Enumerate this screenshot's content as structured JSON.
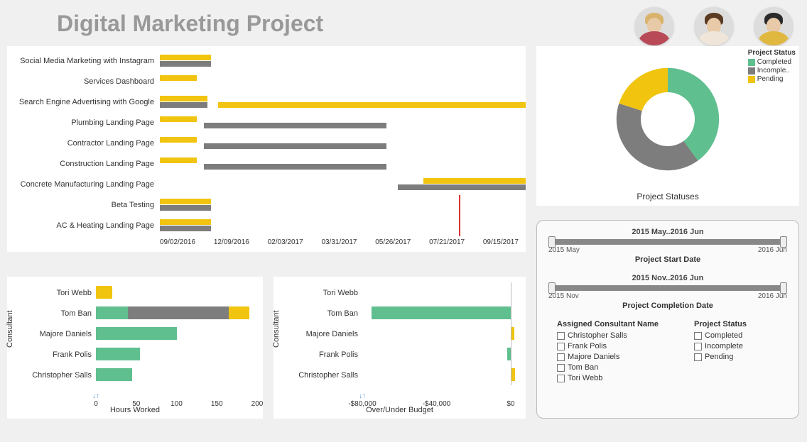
{
  "title": "Digital Marketing Project",
  "avatars": [
    {
      "name": "avatar-1",
      "hair": "#d9b36b",
      "body": "#b84a58"
    },
    {
      "name": "avatar-2",
      "hair": "#5a3a22",
      "body": "#efe6d9"
    },
    {
      "name": "avatar-3",
      "hair": "#2a2a2a",
      "body": "#e0b840"
    }
  ],
  "colors": {
    "completed": "#5fbf8f",
    "incomplete": "#7d7d7d",
    "pending": "#f1c40f"
  },
  "gantt": {
    "axis_labels": [
      "09/02/2016",
      "12/09/2016",
      "02/03/2017",
      "03/31/2017",
      "05/26/2017",
      "07/21/2017",
      "09/15/2017"
    ],
    "reference_date": "07/21/2017",
    "rows": [
      {
        "label": "Social Media Marketing with Instagram",
        "bars": [
          {
            "color": "pending",
            "start": 0,
            "end": 14
          },
          {
            "color": "incomplete",
            "start": 0,
            "end": 14
          }
        ]
      },
      {
        "label": "Services Dashboard",
        "bars": [
          {
            "color": "pending",
            "start": 0,
            "end": 10
          }
        ]
      },
      {
        "label": "Search Engine Advertising with Google",
        "bars": [
          {
            "color": "pending",
            "start": 0,
            "end": 13
          },
          {
            "color": "pending",
            "start": 16,
            "end": 65
          },
          {
            "color": "pending",
            "start": 65,
            "end": 100
          },
          {
            "color": "incomplete",
            "start": 0,
            "end": 13
          }
        ]
      },
      {
        "label": "Plumbing Landing Page",
        "bars": [
          {
            "color": "pending",
            "start": 0,
            "end": 10
          },
          {
            "color": "incomplete",
            "start": 12,
            "end": 62
          }
        ]
      },
      {
        "label": "Contractor Landing Page",
        "bars": [
          {
            "color": "pending",
            "start": 0,
            "end": 10
          },
          {
            "color": "incomplete",
            "start": 12,
            "end": 62
          }
        ]
      },
      {
        "label": "Construction Landing Page",
        "bars": [
          {
            "color": "pending",
            "start": 0,
            "end": 10
          },
          {
            "color": "incomplete",
            "start": 12,
            "end": 62
          }
        ]
      },
      {
        "label": "Concrete Manufacturing Landing Page",
        "bars": [
          {
            "color": "pending",
            "start": 72,
            "end": 100
          },
          {
            "color": "incomplete",
            "start": 65,
            "end": 100
          }
        ]
      },
      {
        "label": "Beta Testing",
        "bars": [
          {
            "color": "pending",
            "start": 0,
            "end": 14
          },
          {
            "color": "incomplete",
            "start": 0,
            "end": 14
          }
        ]
      },
      {
        "label": "AC & Heating Landing Page",
        "bars": [
          {
            "color": "pending",
            "start": 0,
            "end": 14
          },
          {
            "color": "incomplete",
            "start": 0,
            "end": 14
          }
        ]
      }
    ]
  },
  "donut": {
    "caption": "Project Statuses",
    "legend_title": "Project Status",
    "legend": [
      {
        "label": "Completed",
        "color": "completed"
      },
      {
        "label": "Incomple..",
        "color": "incomplete"
      },
      {
        "label": "Pending",
        "color": "pending"
      }
    ]
  },
  "hours_chart": {
    "ylabel": "Consultant",
    "xlabel": "Hours Worked",
    "x_ticks": [
      "0",
      "50",
      "100",
      "150",
      "200"
    ],
    "series_colors": [
      "completed",
      "incomplete",
      "pending"
    ]
  },
  "budget_chart": {
    "ylabel": "Consultant",
    "xlabel": "Over/Under Budget",
    "x_ticks": [
      "-$80,000",
      "-$40,000",
      "$0"
    ]
  },
  "filters": {
    "slider1": {
      "range_label": "2015 May..2016 Jun",
      "min_label": "2015 May",
      "max_label": "2016 Jun",
      "name": "Project Start Date",
      "fill_start": 0,
      "fill_end": 100
    },
    "slider2": {
      "range_label": "2015 Nov..2016 Jun",
      "min_label": "2015 Nov",
      "max_label": "2016 Jun",
      "name": "Project Completion Date",
      "fill_start": 0,
      "fill_end": 100
    },
    "consultant_title": "Assigned Consultant Name",
    "consultants": [
      "Christopher Salls",
      "Frank Polis",
      "Majore Daniels",
      "Tom Ban",
      "Tori Webb"
    ],
    "status_title": "Project Status",
    "statuses": [
      "Completed",
      "Incomplete",
      "Pending"
    ]
  },
  "chart_data": [
    {
      "type": "bar",
      "title": "Project Gantt",
      "orientation": "horizontal",
      "x_axis_type": "date",
      "x_ticks": [
        "09/02/2016",
        "12/09/2016",
        "02/03/2017",
        "03/31/2017",
        "05/26/2017",
        "07/21/2017",
        "09/15/2017"
      ],
      "reference_line": "07/21/2017",
      "categories": [
        "Social Media Marketing with Instagram",
        "Services Dashboard",
        "Search Engine Advertising with Google",
        "Plumbing Landing Page",
        "Contractor Landing Page",
        "Construction Landing Page",
        "Concrete Manufacturing Landing Page",
        "Beta Testing",
        "AC & Heating Landing Page"
      ],
      "bars": [
        {
          "category": "Social Media Marketing with Instagram",
          "status": "Pending",
          "start": "09/02/2016",
          "end": "10/24/2016"
        },
        {
          "category": "Social Media Marketing with Instagram",
          "status": "Incomplete",
          "start": "09/02/2016",
          "end": "10/24/2016"
        },
        {
          "category": "Services Dashboard",
          "status": "Pending",
          "start": "09/02/2016",
          "end": "10/09/2016"
        },
        {
          "category": "Search Engine Advertising with Google",
          "status": "Pending",
          "start": "09/02/2016",
          "end": "10/20/2016"
        },
        {
          "category": "Search Engine Advertising with Google",
          "status": "Pending",
          "start": "11/01/2016",
          "end": "05/10/2017"
        },
        {
          "category": "Search Engine Advertising with Google",
          "status": "Pending",
          "start": "05/10/2017",
          "end": "09/15/2017"
        },
        {
          "category": "Search Engine Advertising with Google",
          "status": "Incomplete",
          "start": "09/02/2016",
          "end": "10/20/2016"
        },
        {
          "category": "Plumbing Landing Page",
          "status": "Pending",
          "start": "09/02/2016",
          "end": "10/09/2016"
        },
        {
          "category": "Plumbing Landing Page",
          "status": "Incomplete",
          "start": "10/16/2016",
          "end": "04/28/2017"
        },
        {
          "category": "Contractor Landing Page",
          "status": "Pending",
          "start": "09/02/2016",
          "end": "10/09/2016"
        },
        {
          "category": "Contractor Landing Page",
          "status": "Incomplete",
          "start": "10/16/2016",
          "end": "04/28/2017"
        },
        {
          "category": "Construction Landing Page",
          "status": "Pending",
          "start": "09/02/2016",
          "end": "10/09/2016"
        },
        {
          "category": "Construction Landing Page",
          "status": "Incomplete",
          "start": "10/16/2016",
          "end": "04/28/2017"
        },
        {
          "category": "Concrete Manufacturing Landing Page",
          "status": "Pending",
          "start": "06/05/2017",
          "end": "09/15/2017"
        },
        {
          "category": "Concrete Manufacturing Landing Page",
          "status": "Incomplete",
          "start": "05/10/2017",
          "end": "09/15/2017"
        },
        {
          "category": "Beta Testing",
          "status": "Pending",
          "start": "09/02/2016",
          "end": "10/24/2016"
        },
        {
          "category": "Beta Testing",
          "status": "Incomplete",
          "start": "09/02/2016",
          "end": "10/24/2016"
        },
        {
          "category": "AC & Heating Landing Page",
          "status": "Pending",
          "start": "09/02/2016",
          "end": "10/24/2016"
        },
        {
          "category": "AC & Heating Landing Page",
          "status": "Incomplete",
          "start": "09/02/2016",
          "end": "10/24/2016"
        }
      ]
    },
    {
      "type": "pie",
      "title": "Project Statuses",
      "slices": [
        {
          "label": "Completed",
          "value": 40,
          "color": "#5fbf8f"
        },
        {
          "label": "Incomplete",
          "value": 40,
          "color": "#7d7d7d"
        },
        {
          "label": "Pending",
          "value": 20,
          "color": "#f1c40f"
        }
      ],
      "donut": true
    },
    {
      "type": "bar",
      "title": "Hours Worked",
      "orientation": "horizontal",
      "xlabel": "Hours Worked",
      "ylabel": "Consultant",
      "xlim": [
        0,
        200
      ],
      "x_ticks": [
        0,
        50,
        100,
        150,
        200
      ],
      "categories": [
        "Tori Webb",
        "Tom Ban",
        "Majore Daniels",
        "Frank Polis",
        "Christopher Salls"
      ],
      "stacked": true,
      "series": [
        {
          "name": "Completed",
          "color": "#5fbf8f",
          "values": [
            0,
            40,
            100,
            55,
            45
          ]
        },
        {
          "name": "Incomplete",
          "color": "#7d7d7d",
          "values": [
            0,
            125,
            0,
            0,
            0
          ]
        },
        {
          "name": "Pending",
          "color": "#f1c40f",
          "values": [
            20,
            25,
            0,
            0,
            0
          ]
        }
      ]
    },
    {
      "type": "bar",
      "title": "Over/Under Budget",
      "orientation": "horizontal",
      "xlabel": "Over/Under Budget",
      "ylabel": "Consultant",
      "xlim": [
        -80000,
        5000
      ],
      "x_ticks": [
        -80000,
        -40000,
        0
      ],
      "categories": [
        "Tori Webb",
        "Tom Ban",
        "Majore Daniels",
        "Frank Polis",
        "Christopher Salls"
      ],
      "series": [
        {
          "name": "Completed",
          "color": "#5fbf8f",
          "values": [
            0,
            -75000,
            0,
            -2000,
            0
          ]
        },
        {
          "name": "Pending",
          "color": "#f1c40f",
          "values": [
            0,
            0,
            2000,
            0,
            2500
          ]
        }
      ]
    }
  ]
}
